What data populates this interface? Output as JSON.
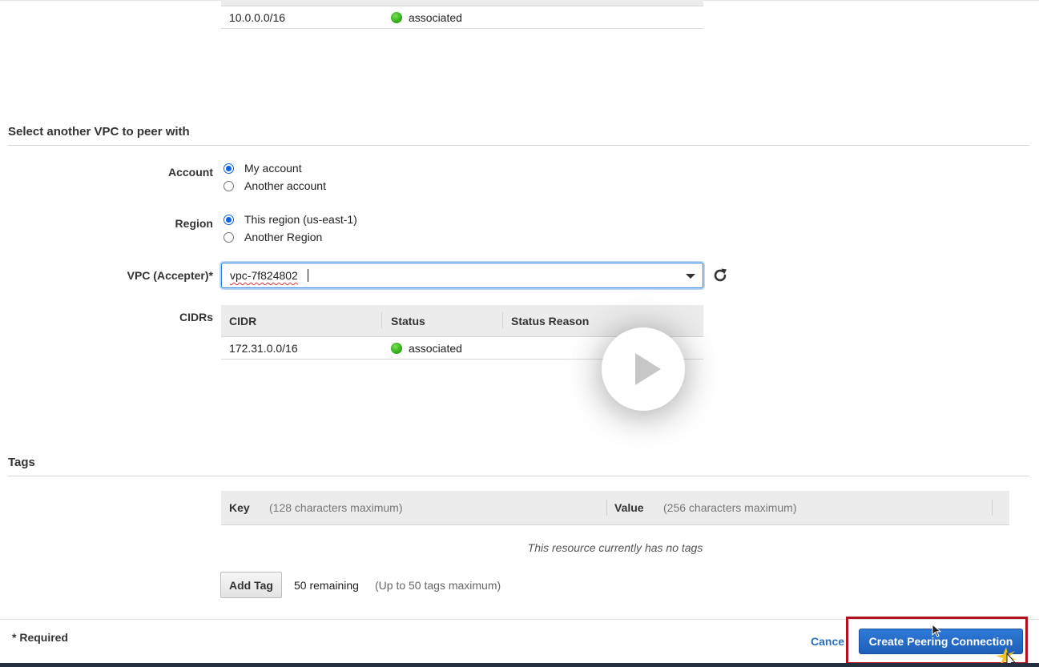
{
  "requester_cidr": {
    "cidr": "10.0.0.0/16",
    "status": "associated"
  },
  "peer_section": {
    "title": "Select another VPC to peer with",
    "account": {
      "label": "Account",
      "options": [
        "My account",
        "Another account"
      ],
      "selected": "My account"
    },
    "region": {
      "label": "Region",
      "options": [
        "This region (us-east-1)",
        "Another Region"
      ],
      "selected": "This region (us-east-1)"
    },
    "vpc": {
      "label": "VPC (Accepter)*",
      "value": "vpc-7f824802"
    },
    "cidrs": {
      "label": "CIDRs",
      "columns": [
        "CIDR",
        "Status",
        "Status Reason"
      ],
      "rows": [
        {
          "cidr": "172.31.0.0/16",
          "status": "associated",
          "reason": ""
        }
      ]
    }
  },
  "tags": {
    "title": "Tags",
    "key_label": "Key",
    "key_hint": "(128 characters maximum)",
    "value_label": "Value",
    "value_hint": "(256 characters maximum)",
    "empty_text": "This resource currently has no tags",
    "add_button": "Add Tag",
    "remaining": "50 remaining",
    "max_note": "(Up to 50 tags maximum)"
  },
  "footer": {
    "required_note": "* Required",
    "cancel": "Cancel",
    "create": "Create Peering Connection"
  },
  "colors": {
    "accent": "#1e5fb8",
    "highlight": "#b3101d",
    "status_green": "#35b21c"
  }
}
